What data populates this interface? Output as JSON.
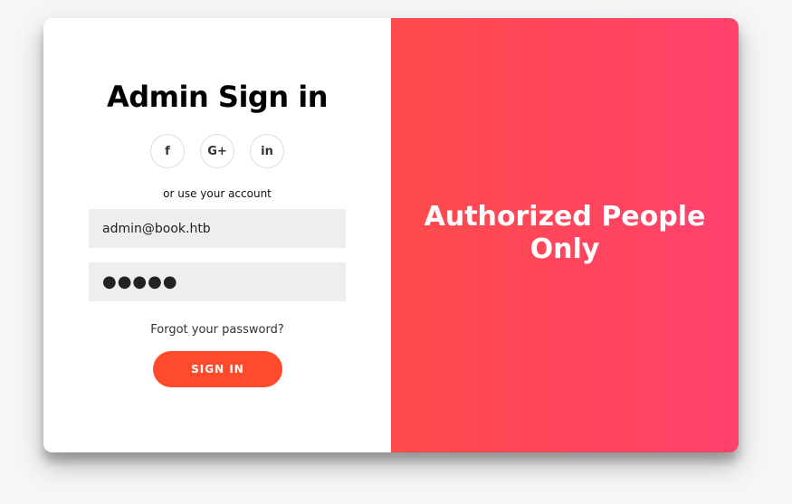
{
  "form": {
    "title": "Admin Sign in",
    "socials": [
      {
        "icon": "facebook-icon",
        "glyph": "f"
      },
      {
        "icon": "google-plus-icon",
        "glyph": "G+"
      },
      {
        "icon": "linkedin-icon",
        "glyph": "in"
      }
    ],
    "or_text": "or use your account",
    "email_value": "admin@book.htb",
    "password_value": "●●●●●",
    "forgot_label": "Forgot your password?",
    "signin_label": "SIGN IN"
  },
  "overlay": {
    "line1": "Authorized People",
    "line2": "Only"
  },
  "colors": {
    "accent": "#ff4b2b",
    "gradient_start": "#ff4b4b",
    "gradient_end": "#ff416c"
  }
}
